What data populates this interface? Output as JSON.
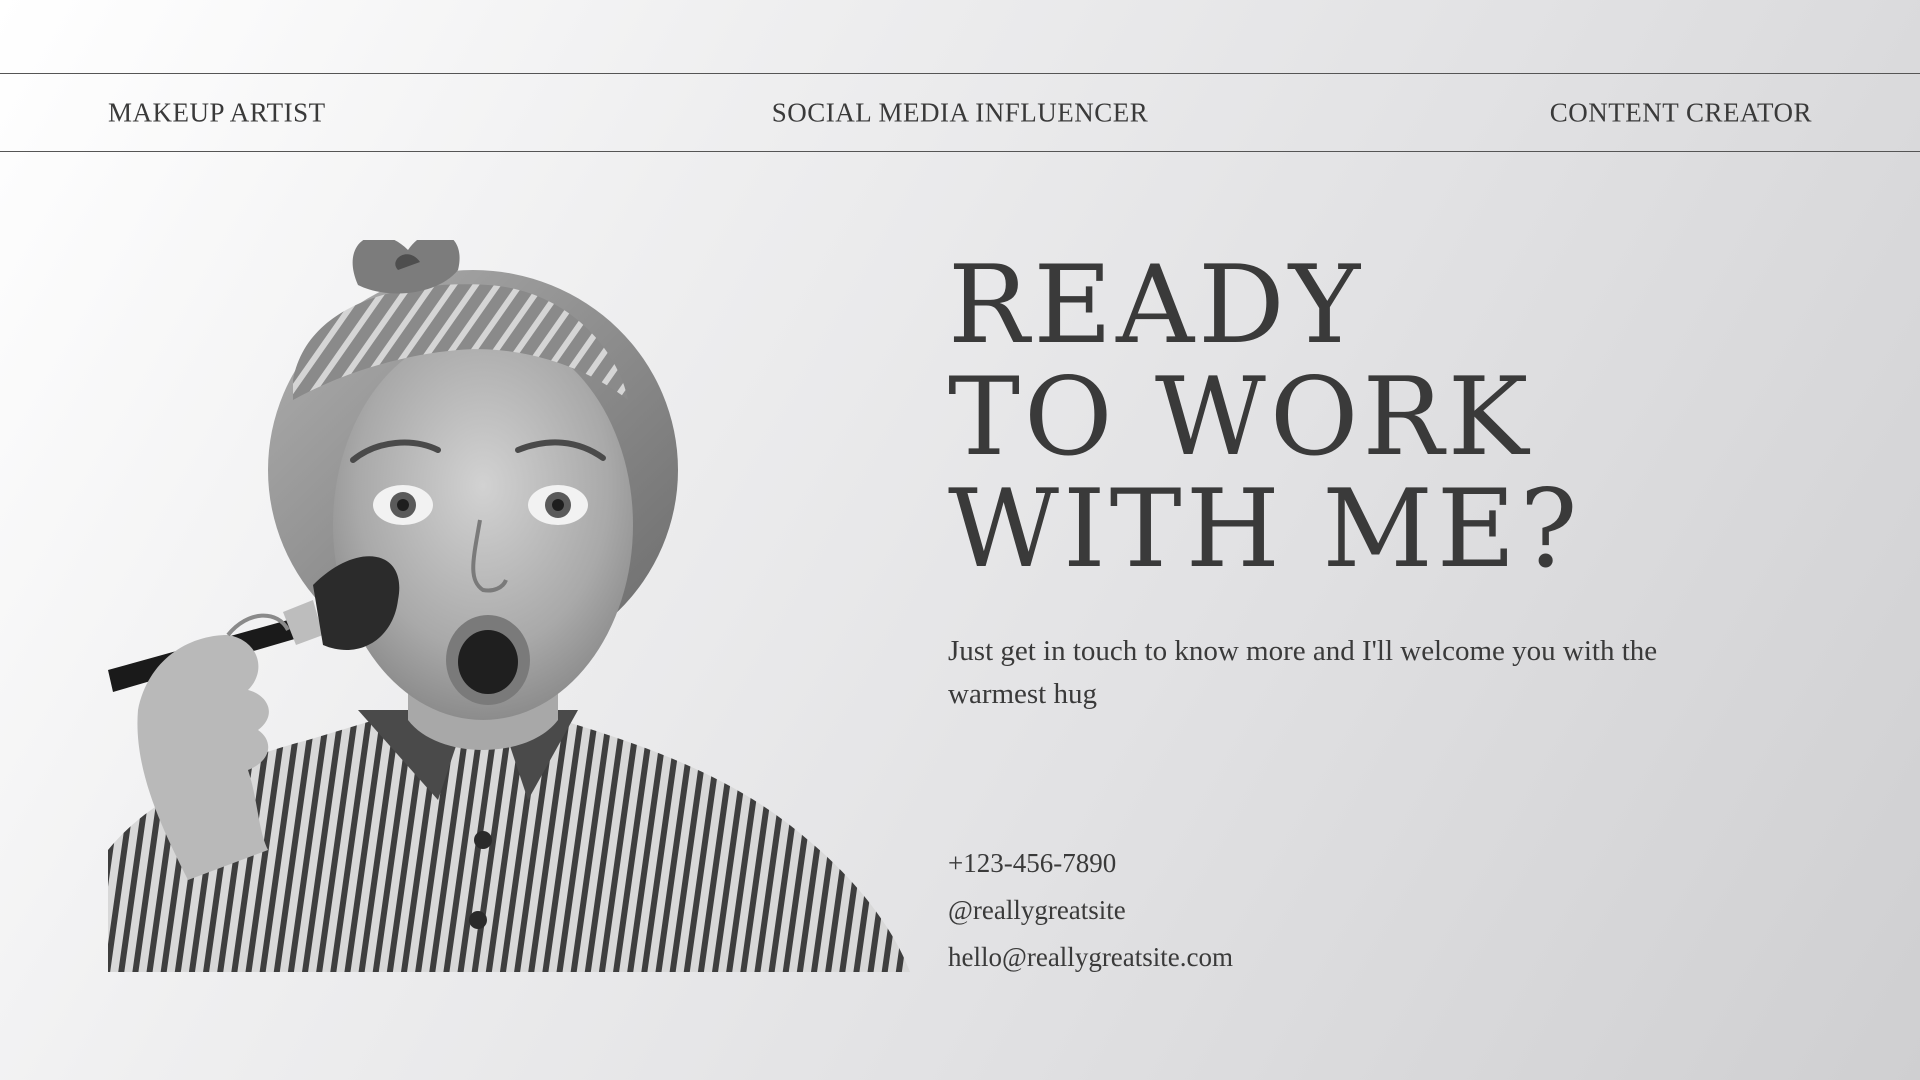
{
  "roles": {
    "left": "MAKEUP ARTIST",
    "center": "SOCIAL MEDIA INFLUENCER",
    "right": "CONTENT CREATOR"
  },
  "headline": {
    "line1": "READY",
    "line2": "TO WORK",
    "line3": "WITH ME?"
  },
  "intro": "Just get in touch to know more and I'll welcome you with the warmest hug",
  "contacts": {
    "phone": "+123-456-7890",
    "social": "@reallygreatsite",
    "email": "hello@reallygreatsite.com"
  },
  "colors": {
    "text": "#3a3a3a",
    "rule": "#555555"
  }
}
